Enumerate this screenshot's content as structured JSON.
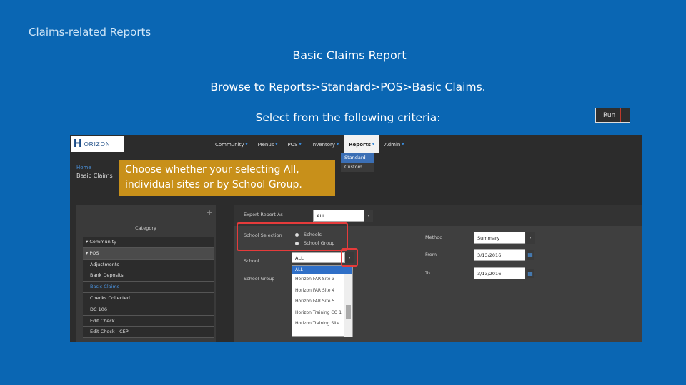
{
  "slide": {
    "kicker": "Claims-related Reports",
    "title": "Basic Claims Report",
    "line1": "Browse to Reports>Standard>POS>Basic Claims.",
    "line2": "Select from the following criteria:",
    "run_label": "Run",
    "callout_line1": "Choose whether your selecting All,",
    "callout_line2": "individual sites or by School Group."
  },
  "app": {
    "logo_h": "H",
    "logo_text": "ORIZON",
    "nav": [
      {
        "label": "Community"
      },
      {
        "label": "Menus"
      },
      {
        "label": "POS"
      },
      {
        "label": "Inventory"
      },
      {
        "label": "Reports"
      },
      {
        "label": "Admin"
      }
    ],
    "reports_menu": [
      "Standard",
      "Custom"
    ],
    "breadcrumb_home": "Home",
    "page_title": "Basic Claims",
    "sidebar": {
      "plus": "+",
      "category": "Category",
      "items": [
        {
          "label": "Community"
        },
        {
          "label": "POS"
        },
        {
          "label": "Adjustments"
        },
        {
          "label": "Bank Deposits"
        },
        {
          "label": "Basic Claims"
        },
        {
          "label": "Checks Collected"
        },
        {
          "label": "DC 106"
        },
        {
          "label": "Edit Check"
        },
        {
          "label": "Edit Check - CEP"
        }
      ]
    },
    "form": {
      "export_label": "Export Report As",
      "export_value": "ALL",
      "school_selection_label": "School Selection",
      "radio_schools": "Schools",
      "radio_group": "School Group",
      "school_label": "School",
      "school_value": "ALL",
      "school_group_label": "School Group",
      "method_label": "Method",
      "method_value": "Summary",
      "from_label": "From",
      "from_value": "3/13/2016",
      "to_label": "To",
      "to_value": "3/13/2016",
      "school_options": [
        "ALL",
        "Horizon FAR Site 3",
        "Horizon FAR Site 4",
        "Horizon FAR Site 5",
        "Horizon Training CO 1",
        "Horizon Training Site"
      ]
    }
  },
  "colors": {
    "slide_bg": "#0a66b3",
    "callout_bg": "#c8901a",
    "highlight_border": "#e53b3b",
    "app_dark": "#2c2c2c"
  }
}
